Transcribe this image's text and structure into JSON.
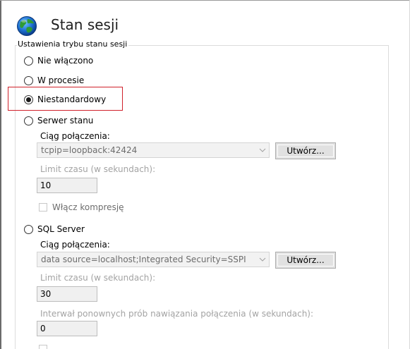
{
  "page": {
    "title": "Stan sesji",
    "icon": "globe-icon"
  },
  "mode_group": {
    "legend": "Ustawienia trybu stanu sesji",
    "selected": "Niestandardowy",
    "options": [
      {
        "label": "Nie włączono",
        "selected": false
      },
      {
        "label": "W procesie",
        "selected": false
      },
      {
        "label": "Niestandardowy",
        "selected": true
      },
      {
        "label": "Serwer stanu",
        "selected": false
      },
      {
        "label": "SQL Server",
        "selected": false
      }
    ]
  },
  "state_server": {
    "connection_label": "Ciąg połączenia:",
    "connection_value": "tcpip=loopback:42424",
    "create_button": "Utwórz...",
    "timeout_label": "Limit czasu (w sekundach):",
    "timeout_value": "10",
    "compression_label": "Włącz kompresję",
    "compression_checked": false
  },
  "sql_server": {
    "connection_label": "Ciąg połączenia:",
    "connection_value": "data source=localhost;Integrated Security=SSPI",
    "create_button": "Utwórz...",
    "timeout_label": "Limit czasu (w sekundach):",
    "timeout_value": "30",
    "retry_label": "Interwał ponownych prób nawiązania połączenia (w sekundach):",
    "retry_value": "0"
  },
  "colors": {
    "highlight": "#d0202a",
    "disabled_text": "#a3a3a3"
  }
}
